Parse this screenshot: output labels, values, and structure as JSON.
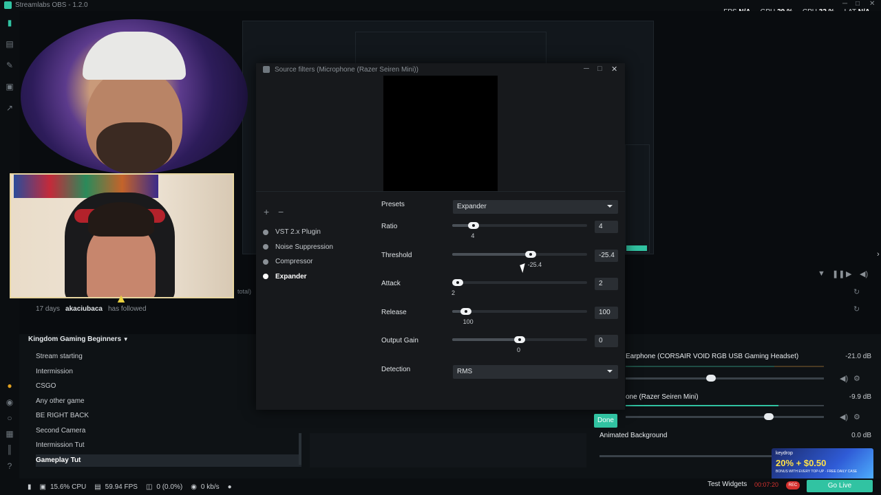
{
  "app": {
    "title": "Streamlabs OBS - 1.2.0"
  },
  "perf": {
    "fps_label": "FPS",
    "fps_value": "N/A",
    "gpu_label": "GPU",
    "gpu_value": "29 %",
    "cpu_label": "CPU",
    "cpu_value": "32 %",
    "lat_label": "LAT",
    "lat_value": "N/A"
  },
  "activity": {
    "time": "17 days",
    "user": "akaciubaca",
    "action": "has followed",
    "total_label": "total)"
  },
  "scenes": {
    "collection": "Kingdom Gaming Beginners",
    "items": [
      "Stream starting",
      "Intermission",
      "CSGO",
      "Any other game",
      "BE RIGHT BACK",
      "Second Camera",
      "Intermission Tut",
      "Gameplay Tut"
    ],
    "active_index": 7
  },
  "mixer": {
    "items": [
      {
        "name": "Earphone (CORSAIR VOID RGB USB Gaming Headset)",
        "db": "-21.0 dB"
      },
      {
        "name": "one (Razer Seiren Mini)",
        "db": "-9.9 dB"
      },
      {
        "name": "Animated Background",
        "db": "0.0 dB"
      }
    ]
  },
  "dialog": {
    "title": "Source filters (Microphone (Razer Seiren Mini))",
    "filters": [
      "VST 2.x Plugin",
      "Noise Suppression",
      "Compressor",
      "Expander"
    ],
    "active_filter": 3,
    "presets_label": "Presets",
    "presets_value": "Expander",
    "params": [
      {
        "label": "Ratio",
        "value": "4",
        "display": "4",
        "fraction": 0.16
      },
      {
        "label": "Threshold",
        "value": "-25.4",
        "display": "-25.4",
        "fraction": 0.58
      },
      {
        "label": "Attack",
        "value": "2",
        "display": "2",
        "fraction": 0.0
      },
      {
        "label": "Release",
        "value": "100",
        "display": "100",
        "fraction": 0.1
      },
      {
        "label": "Output Gain",
        "value": "0",
        "display": "0",
        "fraction": 0.5
      }
    ],
    "detection_label": "Detection",
    "detection_value": "RMS",
    "done_label": "Done",
    "add_glyph": "+",
    "remove_glyph": "−"
  },
  "status": {
    "cpu": "15.6% CPU",
    "fps": "59.94 FPS",
    "dropped": "0 (0.0%)",
    "bandwidth": "0 kb/s",
    "test_widgets": "Test Widgets",
    "timer": "00:07:20",
    "rec": "REC",
    "go_live": "Go Live"
  },
  "ad": {
    "brand": "keydrop",
    "promo": "20% + $0.50",
    "sub": "BONUS WITH EVERY TOP-UP · FREE DAILY CASE"
  },
  "icons": {
    "nav": [
      "studio-icon",
      "library-icon",
      "themes-icon",
      "store-icon",
      "stats-icon"
    ],
    "accent": "#31c3a2"
  }
}
